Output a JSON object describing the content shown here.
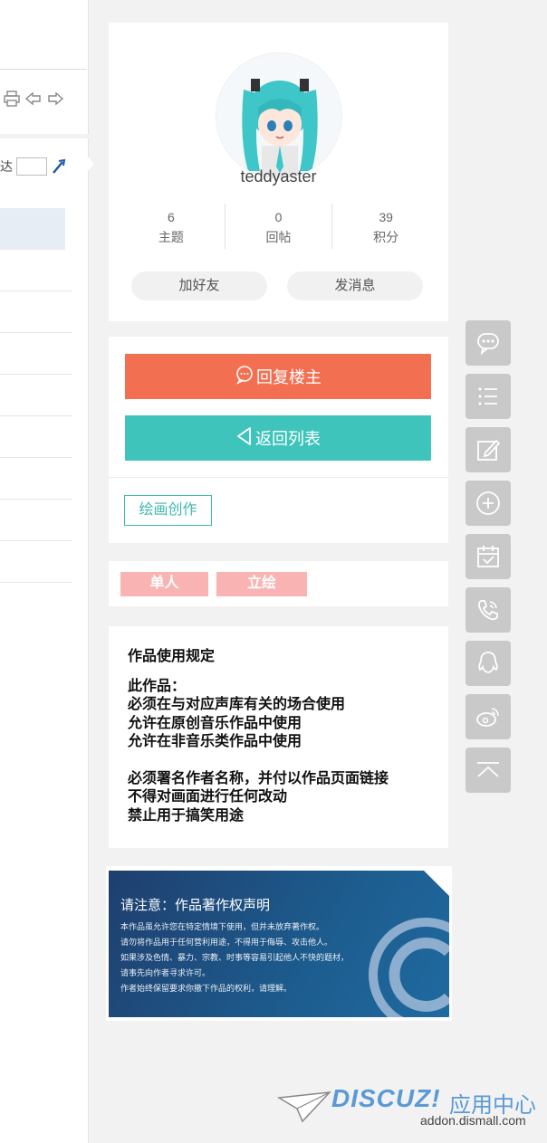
{
  "left": {
    "reach_label": "达"
  },
  "profile": {
    "username": "teddyaster",
    "stats": [
      {
        "value": "6",
        "label": "主题"
      },
      {
        "value": "0",
        "label": "回帖"
      },
      {
        "value": "39",
        "label": "积分"
      }
    ],
    "add_friend_label": "加好友",
    "send_message_label": "发消息"
  },
  "actions": {
    "reply_label": "回复楼主",
    "back_label": "返回列表",
    "category_label": "绘画创作"
  },
  "tags": [
    "单人",
    "立绘"
  ],
  "rules": {
    "title": "作品使用规定",
    "group1": [
      "此作品：",
      "必须在与对应声库有关的场合使用",
      "允许在原创音乐作品中使用",
      "允许在非音乐类作品中使用"
    ],
    "group2": [
      "必须署名作者名称，并付以作品页面链接",
      "不得对画面进行任何改动",
      "禁止用于搞笑用途"
    ]
  },
  "banner": {
    "title": "请注意：作品著作权声明",
    "lines": [
      "本作品虽允许您在特定情境下使用，但并未放弃著作权。",
      "请勿将作品用于任何营利用途，不得用于侮辱、攻击他人。",
      "如果涉及色情、暴力、宗教、时事等容易引起他人不快的题材，",
      "请事先向作者寻求许可。",
      "作者始终保留要求你撤下作品的权利，请理解。"
    ]
  },
  "watermark": {
    "brand": "DISCUZ!",
    "cn": "应用中心",
    "url": "addon.dismall.com"
  },
  "colors": {
    "reply": "#f26f52",
    "back": "#3fc4bb",
    "tag": "#f9b3b3",
    "float_btn": "#c9c9c9"
  }
}
